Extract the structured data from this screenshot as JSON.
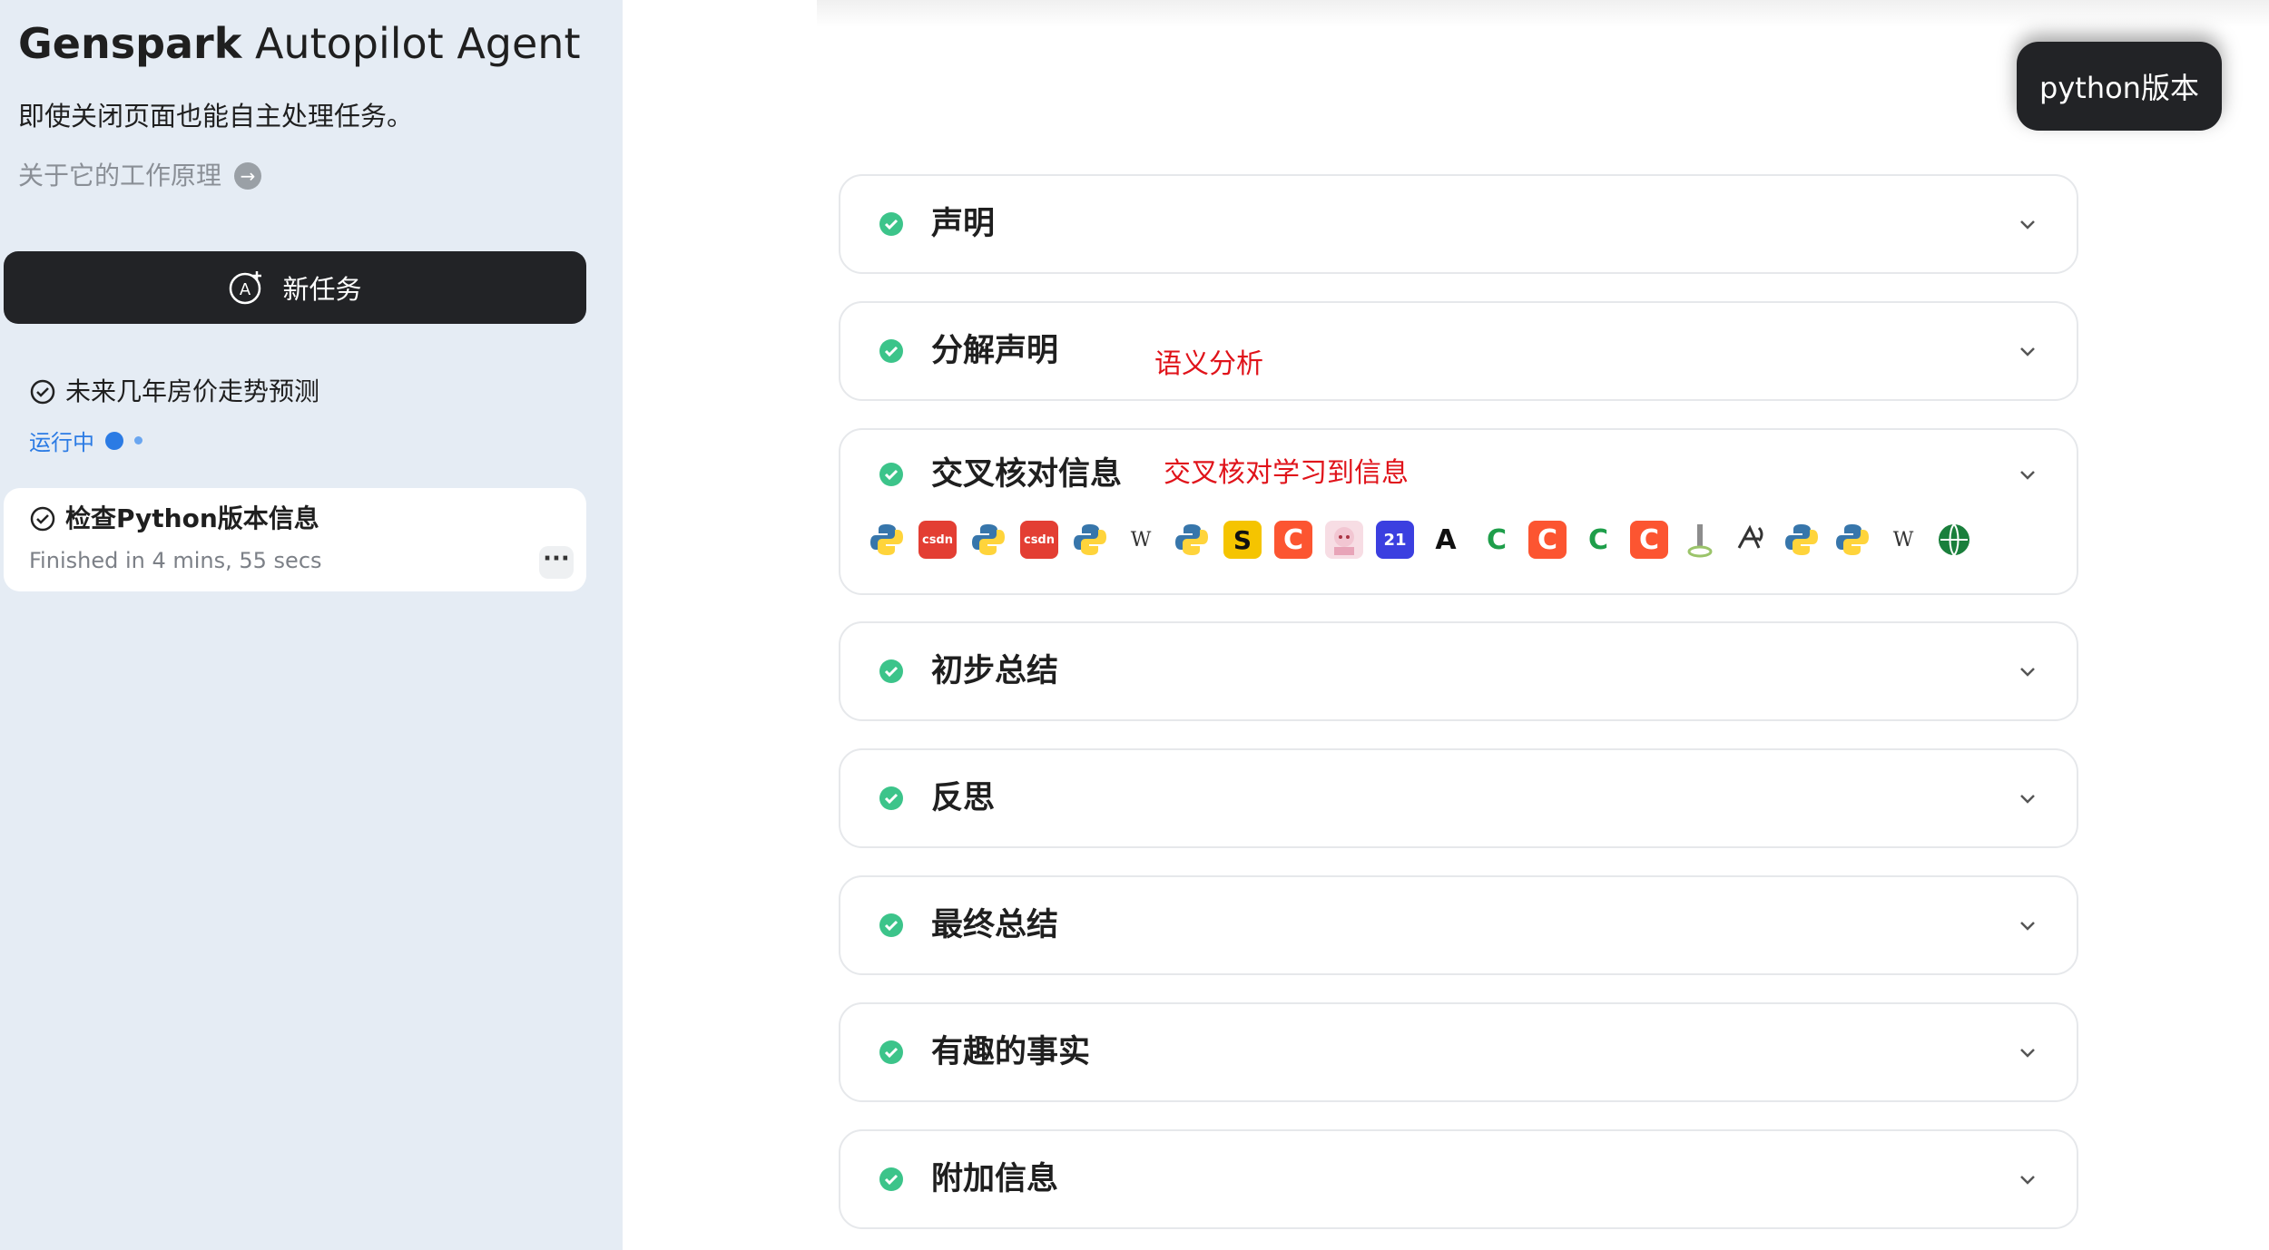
{
  "sidebar": {
    "brand_bold": "Genspark",
    "brand_rest": " Autopilot Agent",
    "tagline": "即使关闭页面也能自主处理任务。",
    "how_link": "关于它的工作原理",
    "new_task": "新任务",
    "tasks": [
      {
        "title": "未来几年房价走势预测",
        "status": "运行中"
      },
      {
        "title": "检查Python版本信息",
        "subtitle": "Finished in 4 mins, 55 secs"
      }
    ]
  },
  "header": {
    "python_button": "python版本"
  },
  "sections": [
    {
      "label": "声明"
    },
    {
      "label": "分解声明",
      "note": "语义分析"
    },
    {
      "label": "交叉核对信息",
      "note": "交叉核对学习到信息"
    },
    {
      "label": "初步总结"
    },
    {
      "label": "反思"
    },
    {
      "label": "最终总结"
    },
    {
      "label": "有趣的事实"
    },
    {
      "label": "附加信息"
    }
  ],
  "sources": [
    {
      "icon": "python-icon",
      "color": "#3776ab"
    },
    {
      "icon": "csdn-icon",
      "text": "csdn",
      "color": "#e33e33"
    },
    {
      "icon": "python-icon",
      "color": "#3776ab"
    },
    {
      "icon": "csdn-icon",
      "text": "csdn",
      "color": "#e33e33"
    },
    {
      "icon": "python-icon",
      "color": "#3776ab"
    },
    {
      "icon": "wikipedia-icon",
      "text": "W",
      "color": "#333333"
    },
    {
      "icon": "python-icon",
      "color": "#3776ab"
    },
    {
      "icon": "s-logo-icon",
      "text": "S",
      "color": "#f5c400"
    },
    {
      "icon": "c-orange-icon",
      "text": "C",
      "color": "#fc5531"
    },
    {
      "icon": "anime-avatar-icon",
      "color": "#f2c6d2"
    },
    {
      "icon": "21-logo-icon",
      "text": "21",
      "color": "#3b3fe0"
    },
    {
      "icon": "a-logo-icon",
      "text": "A",
      "color": "#111111"
    },
    {
      "icon": "c-green-icon",
      "text": "C",
      "color": "#1e9e4a"
    },
    {
      "icon": "c-orange-icon",
      "text": "C",
      "color": "#fc5531"
    },
    {
      "icon": "c-green-icon",
      "text": "C",
      "color": "#1e9e4a"
    },
    {
      "icon": "c-orange-icon",
      "text": "C",
      "color": "#fc5531"
    },
    {
      "icon": "pin-icon",
      "color": "#7a8b6a"
    },
    {
      "icon": "sketch-icon",
      "color": "#333333"
    },
    {
      "icon": "python-icon",
      "color": "#3776ab"
    },
    {
      "icon": "python-icon",
      "color": "#3776ab"
    },
    {
      "icon": "wikipedia-icon",
      "text": "W",
      "color": "#333333"
    },
    {
      "icon": "globe-icon",
      "color": "#1a7f3c"
    }
  ]
}
